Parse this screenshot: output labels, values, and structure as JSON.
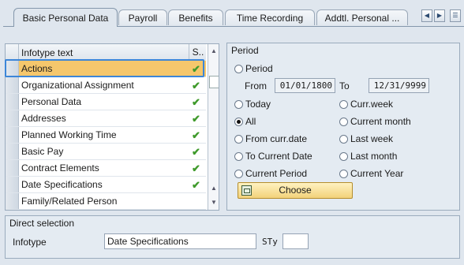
{
  "tabs": [
    {
      "label": "Basic Personal Data",
      "active": true
    },
    {
      "label": "Payroll"
    },
    {
      "label": "Benefits"
    },
    {
      "label": "Time Recording"
    },
    {
      "label": "Addtl. Personal ..."
    }
  ],
  "infotypes": {
    "header": {
      "text": "Infotype text",
      "status": "S.."
    },
    "rows": [
      {
        "label": "Actions",
        "checked": true,
        "selected": true
      },
      {
        "label": "Organizational Assignment",
        "checked": true
      },
      {
        "label": "Personal Data",
        "checked": true
      },
      {
        "label": "Addresses",
        "checked": true
      },
      {
        "label": "Planned Working Time",
        "checked": true
      },
      {
        "label": "Basic Pay",
        "checked": true
      },
      {
        "label": "Contract Elements",
        "checked": true
      },
      {
        "label": "Date Specifications",
        "checked": true
      },
      {
        "label": "Family/Related Person",
        "checked": false
      }
    ]
  },
  "period": {
    "title": "Period",
    "period_label": "Period",
    "from_label": "From",
    "from_value": "01/01/1800",
    "to_label": "To",
    "to_value": "12/31/9999",
    "options_left": [
      "Today",
      "All",
      "From curr.date",
      "To Current Date",
      "Current Period"
    ],
    "options_right": [
      "Curr.week",
      "Current month",
      "Last week",
      "Last month",
      "Current Year"
    ],
    "selected": "All",
    "choose_label": "Choose"
  },
  "direct": {
    "title": "Direct selection",
    "infotype_label": "Infotype",
    "infotype_value": "Date Specifications",
    "sty_label": "STy",
    "sty_value": ""
  },
  "colors": {
    "highlight": "#f5c76c",
    "check": "#3f9a2b",
    "focus": "#3c86d8"
  }
}
